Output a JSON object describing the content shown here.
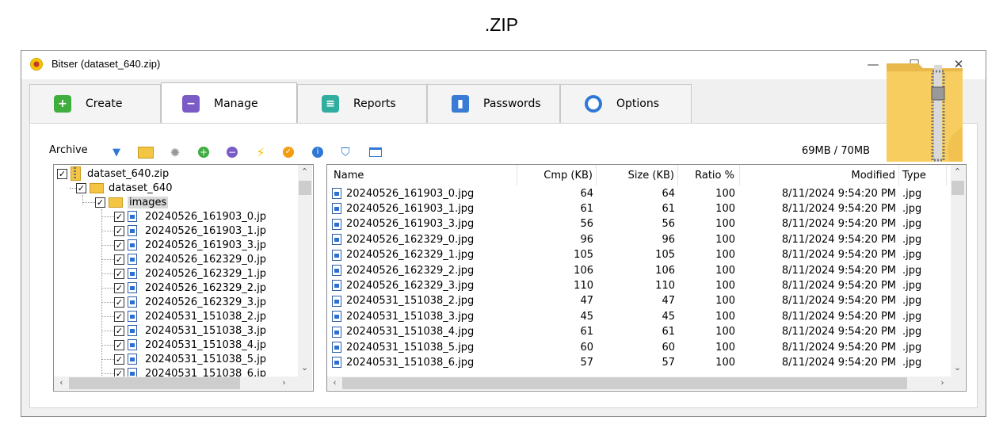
{
  "caption": ".ZIP",
  "window": {
    "title": "Bitser (dataset_640.zip)",
    "controls": {
      "minimize": "—",
      "maximize": "☐",
      "close": "✕"
    }
  },
  "tabs": [
    {
      "label": "Create",
      "icon": "plus-icon",
      "color": "#3fae3f"
    },
    {
      "label": "Manage",
      "icon": "minus-icon",
      "color": "#7b5cc7",
      "active": true
    },
    {
      "label": "Reports",
      "icon": "report-icon",
      "color": "#2fae9f"
    },
    {
      "label": "Passwords",
      "icon": "lock-icon",
      "color": "#3a7bd5"
    },
    {
      "label": "Options",
      "icon": "options-icon",
      "color": "#2f79d6"
    }
  ],
  "toolbar": {
    "label": "Archive",
    "icons": [
      "dropdown-icon",
      "open-folder-icon",
      "settings-gear-icon",
      "add-icon",
      "remove-icon",
      "lightning-icon",
      "test-icon",
      "info-icon",
      "shield-icon",
      "window-icon"
    ],
    "space": "69MB / 70MB"
  },
  "tree": {
    "root": "dataset_640.zip",
    "folder": "dataset_640",
    "subfolder": "images",
    "files": [
      "20240526_161903_0.jp",
      "20240526_161903_1.jp",
      "20240526_161903_3.jp",
      "20240526_162329_0.jp",
      "20240526_162329_1.jp",
      "20240526_162329_2.jp",
      "20240526_162329_3.jp",
      "20240531_151038_2.jp",
      "20240531_151038_3.jp",
      "20240531_151038_4.jp",
      "20240531_151038_5.jp",
      "20240531_151038_6.jp"
    ]
  },
  "list": {
    "columns": [
      "Name",
      "Cmp (KB)",
      "Size (KB)",
      "Ratio %",
      "Modified",
      "Type"
    ],
    "rows": [
      {
        "name": "20240526_161903_0.jpg",
        "cmp": "64",
        "size": "64",
        "ratio": "100",
        "modified": "8/11/2024 9:54:20 PM",
        "type": ".jpg"
      },
      {
        "name": "20240526_161903_1.jpg",
        "cmp": "61",
        "size": "61",
        "ratio": "100",
        "modified": "8/11/2024 9:54:20 PM",
        "type": ".jpg"
      },
      {
        "name": "20240526_161903_3.jpg",
        "cmp": "56",
        "size": "56",
        "ratio": "100",
        "modified": "8/11/2024 9:54:20 PM",
        "type": ".jpg"
      },
      {
        "name": "20240526_162329_0.jpg",
        "cmp": "96",
        "size": "96",
        "ratio": "100",
        "modified": "8/11/2024 9:54:20 PM",
        "type": ".jpg"
      },
      {
        "name": "20240526_162329_1.jpg",
        "cmp": "105",
        "size": "105",
        "ratio": "100",
        "modified": "8/11/2024 9:54:20 PM",
        "type": ".jpg"
      },
      {
        "name": "20240526_162329_2.jpg",
        "cmp": "106",
        "size": "106",
        "ratio": "100",
        "modified": "8/11/2024 9:54:20 PM",
        "type": ".jpg"
      },
      {
        "name": "20240526_162329_3.jpg",
        "cmp": "110",
        "size": "110",
        "ratio": "100",
        "modified": "8/11/2024 9:54:20 PM",
        "type": ".jpg"
      },
      {
        "name": "20240531_151038_2.jpg",
        "cmp": "47",
        "size": "47",
        "ratio": "100",
        "modified": "8/11/2024 9:54:20 PM",
        "type": ".jpg"
      },
      {
        "name": "20240531_151038_3.jpg",
        "cmp": "45",
        "size": "45",
        "ratio": "100",
        "modified": "8/11/2024 9:54:20 PM",
        "type": ".jpg"
      },
      {
        "name": "20240531_151038_4.jpg",
        "cmp": "61",
        "size": "61",
        "ratio": "100",
        "modified": "8/11/2024 9:54:20 PM",
        "type": ".jpg"
      },
      {
        "name": "20240531_151038_5.jpg",
        "cmp": "60",
        "size": "60",
        "ratio": "100",
        "modified": "8/11/2024 9:54:20 PM",
        "type": ".jpg"
      },
      {
        "name": "20240531_151038_6.jpg",
        "cmp": "57",
        "size": "57",
        "ratio": "100",
        "modified": "8/11/2024 9:54:20 PM",
        "type": ".jpg"
      }
    ]
  }
}
